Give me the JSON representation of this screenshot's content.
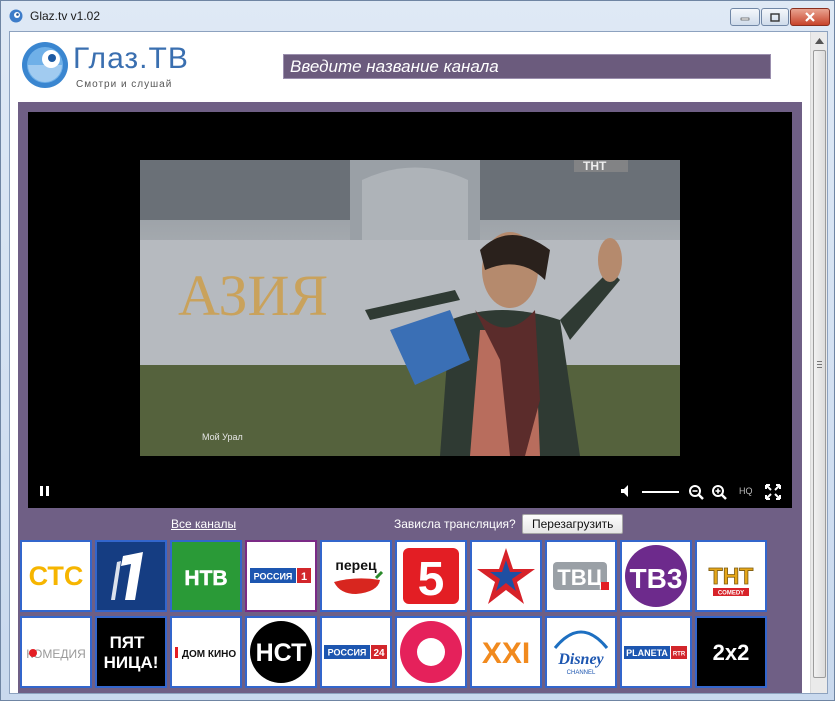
{
  "window": {
    "title": "Glaz.tv v1.02"
  },
  "header": {
    "logo_title": "Глаз.ТВ",
    "logo_subtitle": "Смотри и слушай",
    "search_placeholder": "Введите название канала"
  },
  "player": {
    "watermark": "Мой Урал",
    "wall_text": "АЗИЯ",
    "banner": "ТНТ",
    "hq_label": "HQ",
    "volume_level": 0.85
  },
  "links": {
    "all_channels": "Все каналы",
    "hang_question": "Зависла трансляция?",
    "reload": "Перезагрузить"
  },
  "channels_row1": [
    {
      "name": "СТС",
      "label": "СТС"
    },
    {
      "name": "Первый",
      "label": "1"
    },
    {
      "name": "НТВ",
      "label": "НТВ"
    },
    {
      "name": "Россия 1",
      "label": "РОССИЯ",
      "num": "1"
    },
    {
      "name": "Перец",
      "label": "перец"
    },
    {
      "name": "Пятый",
      "label": "5"
    },
    {
      "name": "Звезда",
      "label": ""
    },
    {
      "name": "ТВЦ",
      "label": "ТВЦ"
    },
    {
      "name": "ТВ3",
      "label": "ТВ3"
    },
    {
      "name": "ТНТ",
      "label": "ТНТ",
      "sub": "COMEDY"
    }
  ],
  "channels_row2": [
    {
      "name": "Комедия",
      "label": "КОМЕДИЯ"
    },
    {
      "name": "Пятница",
      "label": "ПЯТ",
      "label2": "НИЦА!"
    },
    {
      "name": "Дом Кино",
      "label": "ДОМ КИНО"
    },
    {
      "name": "НСТ",
      "label": "НСТ"
    },
    {
      "name": "Россия 24",
      "label": "РОССИЯ",
      "num": "24"
    },
    {
      "name": "Домашний",
      "label": ""
    },
    {
      "name": "XXI",
      "label": "XXI"
    },
    {
      "name": "Disney",
      "label": "Disney",
      "sub": "CHANNEL"
    },
    {
      "name": "Планета RTR",
      "label": "PLANETA",
      "num": "RTR"
    },
    {
      "name": "2x2",
      "label": "2x2"
    }
  ]
}
